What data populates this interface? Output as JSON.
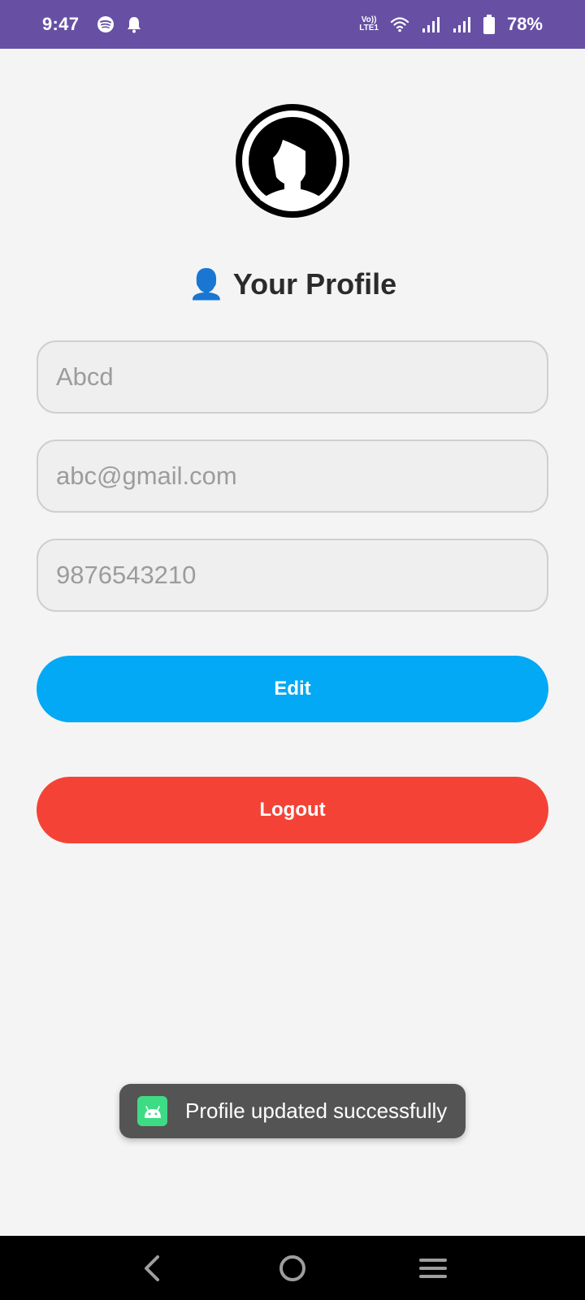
{
  "status_bar": {
    "time": "9:47",
    "battery_percent": "78%",
    "volte_top": "Vo))",
    "volte_bottom": "LTE1",
    "icons": [
      "spotify-icon",
      "notification-bell-icon",
      "volte-icon",
      "wifi-icon",
      "signal-icon",
      "signal-icon",
      "battery-icon"
    ],
    "color": "#6750a4"
  },
  "profile": {
    "title_emoji": "👤",
    "title": "Your Profile",
    "avatar_icon": "user-avatar-icon"
  },
  "form": {
    "name_placeholder": "Abcd",
    "email_placeholder": "abc@gmail.com",
    "phone_placeholder": "9876543210"
  },
  "buttons": {
    "edit_label": "Edit",
    "edit_color": "#03a9f4",
    "logout_label": "Logout",
    "logout_color": "#f44336"
  },
  "toast": {
    "message": "Profile updated successfully",
    "icon": "android-app-icon"
  },
  "nav_bar": {
    "icons": [
      "back-icon",
      "home-icon",
      "recents-icon"
    ]
  }
}
